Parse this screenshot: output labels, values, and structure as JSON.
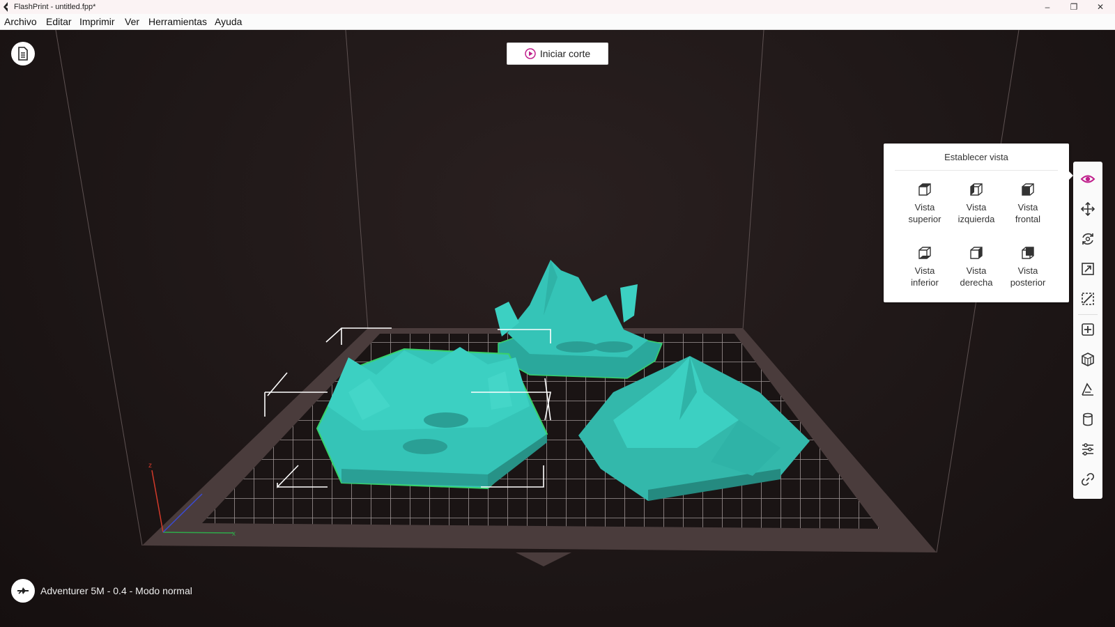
{
  "window": {
    "title": "FlashPrint - untitled.fpp*",
    "minimize": "–",
    "restore": "❐",
    "close": "✕"
  },
  "menu": [
    "Archivo",
    "Editar",
    "Imprimir",
    "Ver",
    "Herramientas",
    "Ayuda"
  ],
  "viewport": {
    "start_button": "Iniciar corte",
    "status_text": "Adventurer 5M - 0.4 - Modo normal",
    "axis_labels": {
      "x": "x",
      "z": "z"
    },
    "model_color": "#35c4b7",
    "selection_color": "#39d16a"
  },
  "view_popup": {
    "title": "Establecer vista",
    "buttons": [
      {
        "line1": "Vista",
        "line2": "superior",
        "icon": "top-view-icon"
      },
      {
        "line1": "Vista",
        "line2": "izquierda",
        "icon": "left-view-icon"
      },
      {
        "line1": "Vista",
        "line2": "frontal",
        "icon": "front-view-icon"
      },
      {
        "line1": "Vista",
        "line2": "inferior",
        "icon": "bottom-view-icon"
      },
      {
        "line1": "Vista",
        "line2": "derecha",
        "icon": "right-view-icon"
      },
      {
        "line1": "Vista",
        "line2": "posterior",
        "icon": "back-view-icon"
      }
    ]
  },
  "toolbar": {
    "accent": "#c0208c",
    "tools": [
      "eye-icon",
      "move-icon",
      "rotate-icon",
      "scale-icon",
      "cut-icon",
      "add-support-icon",
      "extrude-icon",
      "measure-icon",
      "cylinder-icon",
      "settings-sliders-icon",
      "link-icon"
    ]
  }
}
